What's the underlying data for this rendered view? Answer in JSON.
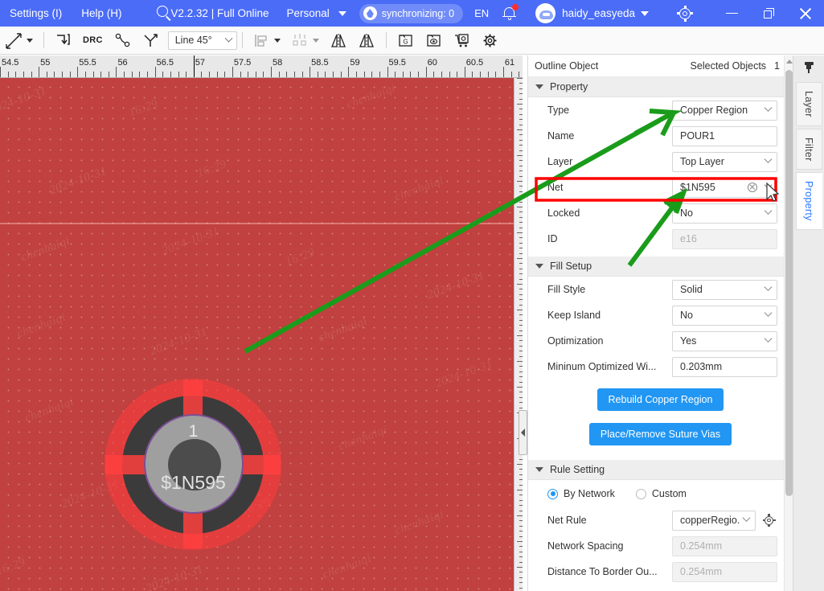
{
  "titlebar": {
    "menu_settings": "Settings (I)",
    "menu_help": "Help (H)",
    "version": "V2.2.32 | Full Online",
    "personal": "Personal",
    "sync_status": "synchronizing: 0",
    "language": "EN",
    "username": "haidy_easyeda"
  },
  "toolbar": {
    "line_mode": "Line 45°",
    "drc_label": "DRC"
  },
  "canvas": {
    "ruler_labels": [
      "54.5",
      "55",
      "55.5",
      "56",
      "56.5",
      "57",
      "57.5",
      "58",
      "58.5",
      "59",
      "59.5",
      "60",
      "60.5",
      "61"
    ],
    "ruler_start": 54.5,
    "ruler_end": 61.25,
    "cursor_position": "57",
    "pad_number": "1",
    "pad_net": "$1N595",
    "background_color": "#c0413f",
    "copper_color": "#ff4040",
    "watermark_text": "chenhaiqi",
    "watermark_date": "2024-10-31",
    "watermark_time": "16:29"
  },
  "panel": {
    "header_title": "Outline Object",
    "selected_objects_label": "Selected Objects",
    "selected_objects_count": "1",
    "sections": {
      "property": {
        "title": "Property",
        "rows": [
          {
            "label": "Type",
            "value": "Copper Region",
            "control": "select"
          },
          {
            "label": "Name",
            "value": "POUR1",
            "control": "text"
          },
          {
            "label": "Layer",
            "value": "Top Layer",
            "control": "select"
          },
          {
            "label": "Net",
            "value": "$1N595",
            "control": "select-clear"
          },
          {
            "label": "Locked",
            "value": "No",
            "control": "select"
          },
          {
            "label": "ID",
            "value": "e16",
            "control": "text-disabled"
          }
        ]
      },
      "fill_setup": {
        "title": "Fill Setup",
        "rows": [
          {
            "label": "Fill Style",
            "value": "Solid",
            "control": "select"
          },
          {
            "label": "Keep Island",
            "value": "No",
            "control": "select"
          },
          {
            "label": "Optimization",
            "value": "Yes",
            "control": "select"
          },
          {
            "label": "Mininum Optimized Wi...",
            "value": "0.203mm",
            "control": "text"
          }
        ],
        "buttons": {
          "rebuild": "Rebuild Copper Region",
          "suture_vias": "Place/Remove Suture Vias"
        }
      },
      "rule_setting": {
        "title": "Rule Setting",
        "radio_by_network": "By Network",
        "radio_custom": "Custom",
        "radio_selected": "By Network",
        "rows": [
          {
            "label": "Net Rule",
            "value": "copperRegio...",
            "control": "select-gear"
          },
          {
            "label": "Network Spacing",
            "value": "0.254mm",
            "control": "text-disabled"
          },
          {
            "label": "Distance To Border Ou...",
            "value": "0.254mm",
            "control": "text-disabled"
          }
        ]
      }
    }
  },
  "right_tabs": {
    "items": [
      {
        "label": "Layer",
        "active": false
      },
      {
        "label": "Filter",
        "active": false
      },
      {
        "label": "Property",
        "active": true
      }
    ]
  },
  "annotations": {
    "highlight_color": "#ff0000",
    "arrow_color": "#1a9c1a",
    "highlighted_field": "Net"
  }
}
